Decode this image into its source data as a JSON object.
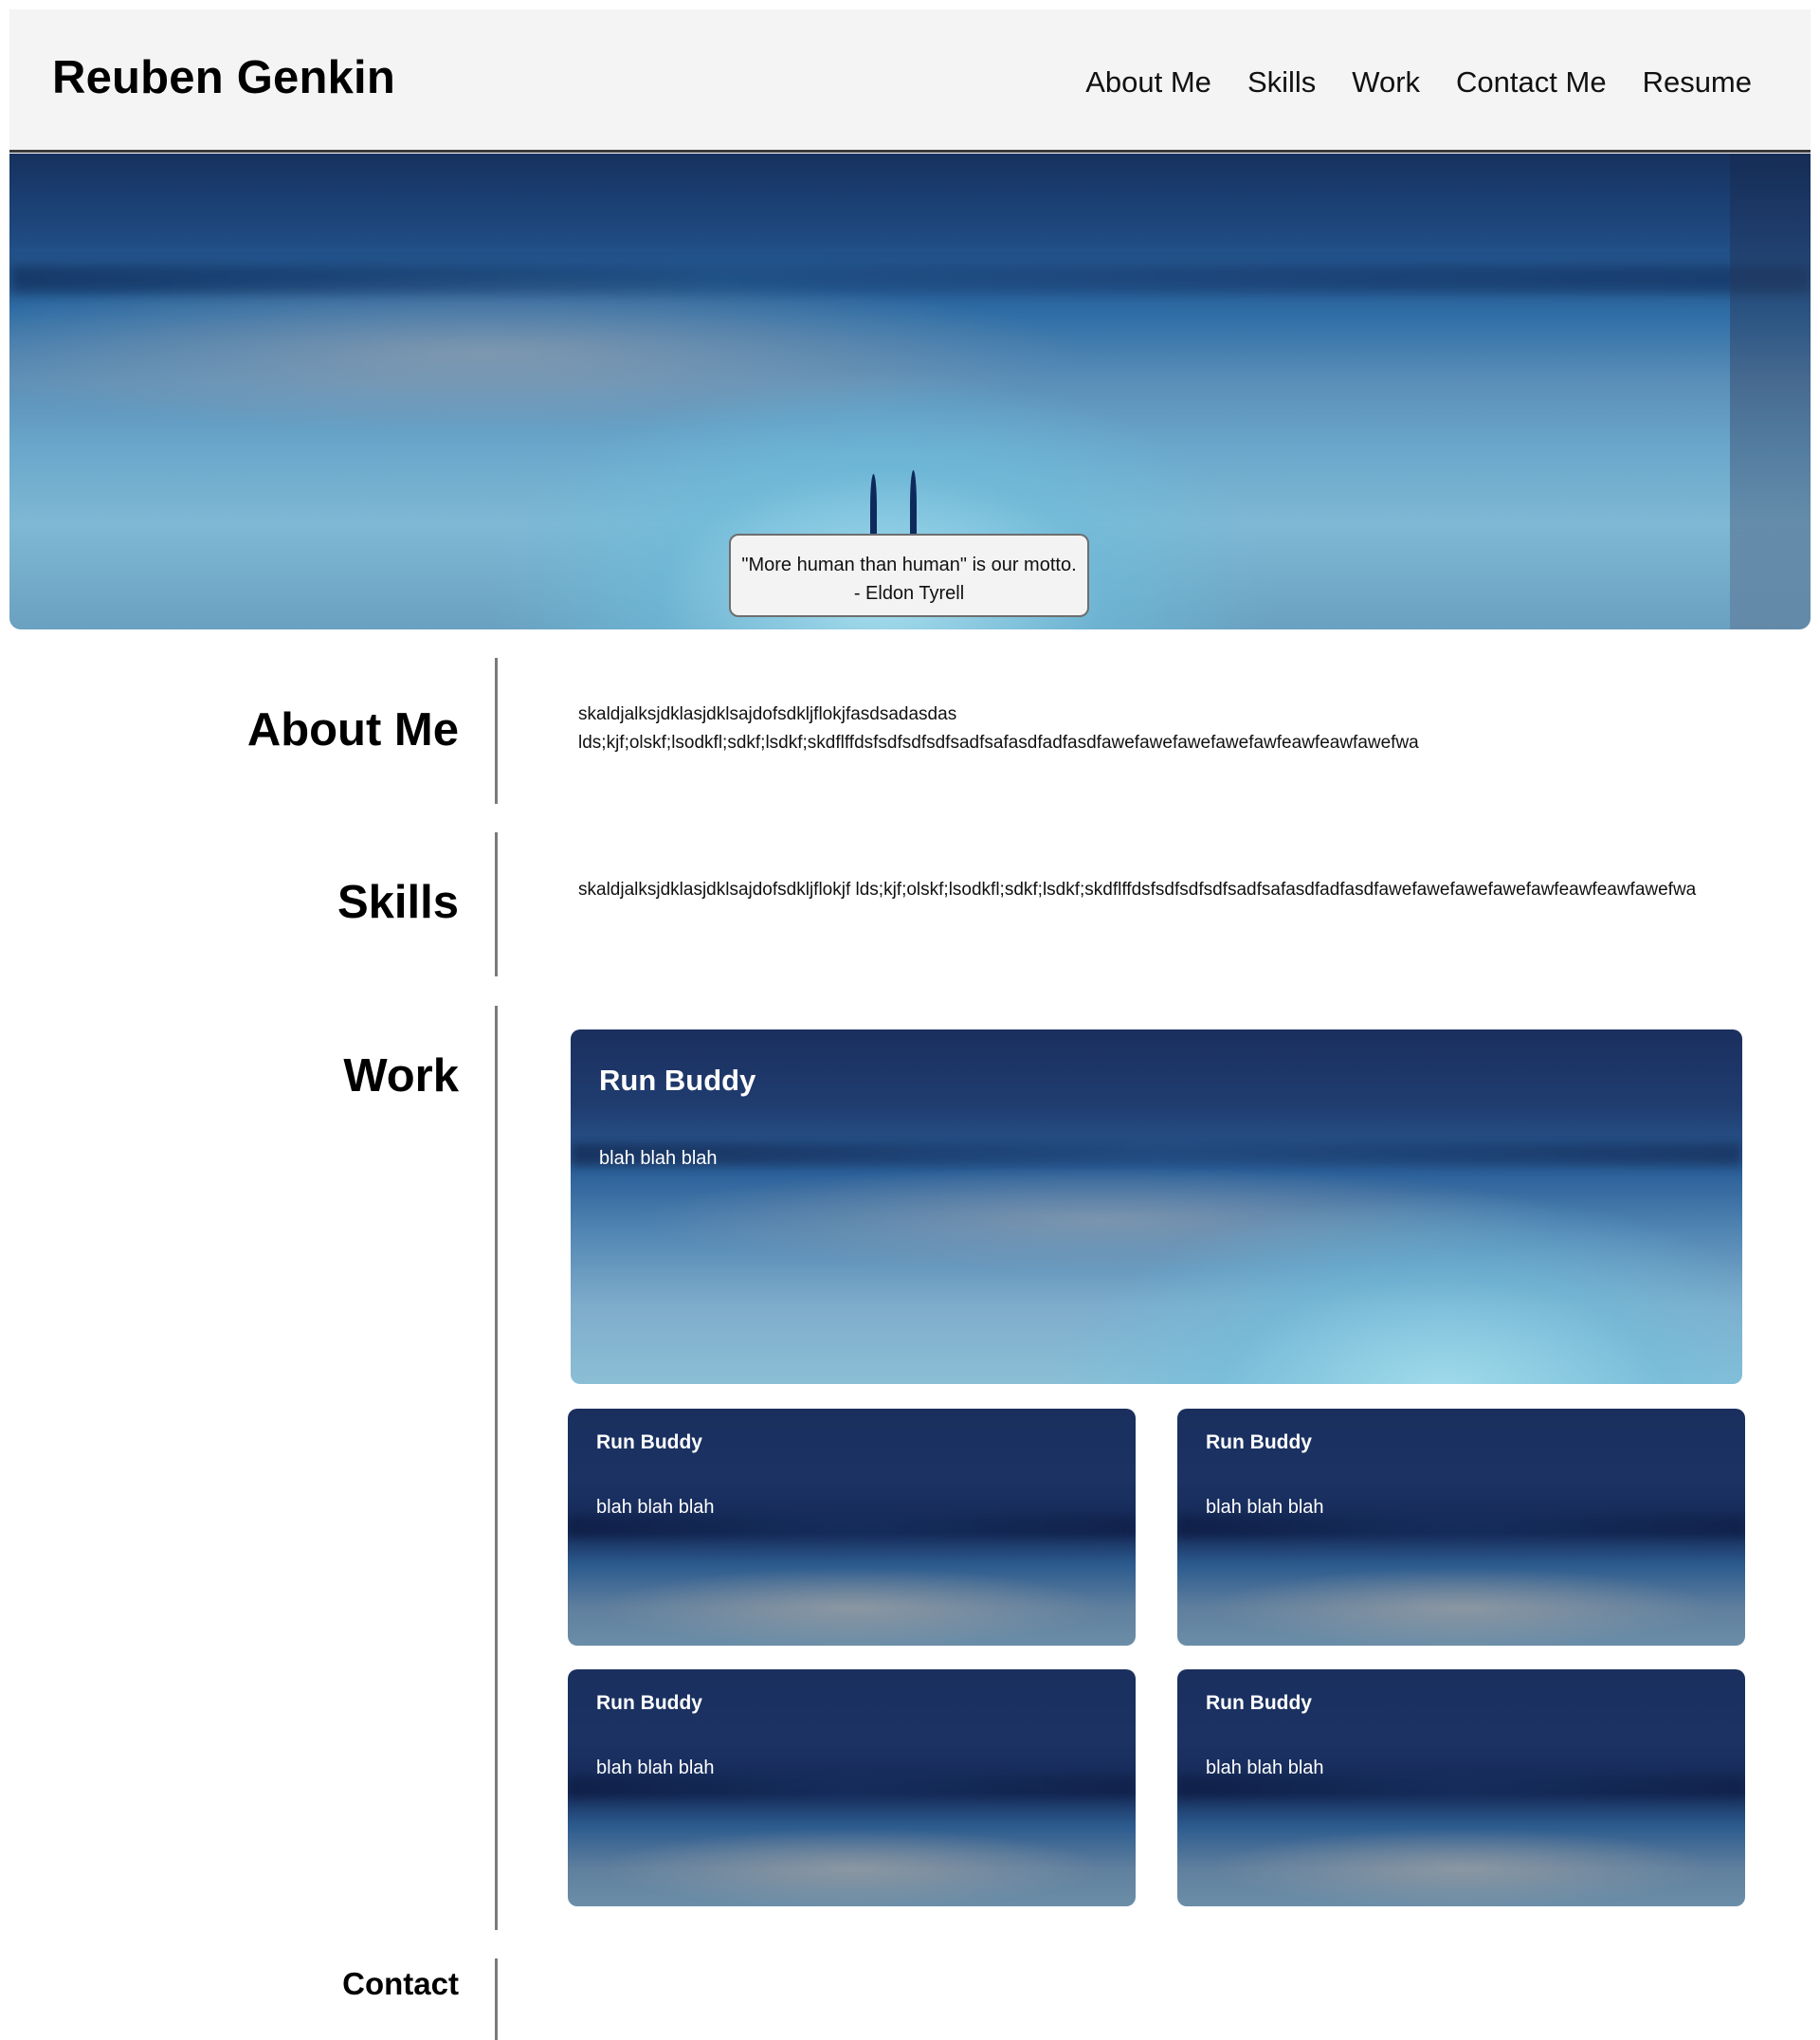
{
  "header": {
    "title": "Reuben Genkin",
    "nav": [
      "About Me",
      "Skills",
      "Work",
      "Contact Me",
      "Resume"
    ]
  },
  "hero": {
    "quote_line1": "\"More human than human\" is our motto.",
    "quote_line2": "- Eldon Tyrell"
  },
  "about": {
    "title": "About Me",
    "line1": "skaldjalksjdklasjdklsajdofsdkljflokjfasdsadasdas",
    "line2": "lds;kjf;olskf;lsodkfl;sdkf;lsdkf;skdflffdsfsdfsdfsdfsadfsafasdfadfasdfawefawefawefawefawfeawfeawfawefwa"
  },
  "skills": {
    "title": "Skills",
    "text": "skaldjalksjdklasjdklsajdofsdkljflokjf lds;kjf;olskf;lsodkfl;sdkf;lsdkf;skdflffdsfsdfsdfsdfsadfsafasdfadfasdfawefawefawefawefawfeawfeawfawefwa"
  },
  "work": {
    "title": "Work",
    "projects": [
      {
        "title": "Run Buddy",
        "description": "blah blah blah"
      },
      {
        "title": "Run Buddy",
        "description": "blah blah blah"
      },
      {
        "title": "Run Buddy",
        "description": "blah blah blah"
      },
      {
        "title": "Run Buddy",
        "description": "blah blah blah"
      },
      {
        "title": "Run Buddy",
        "description": "blah blah blah"
      }
    ]
  },
  "contact": {
    "title": "Contact"
  }
}
